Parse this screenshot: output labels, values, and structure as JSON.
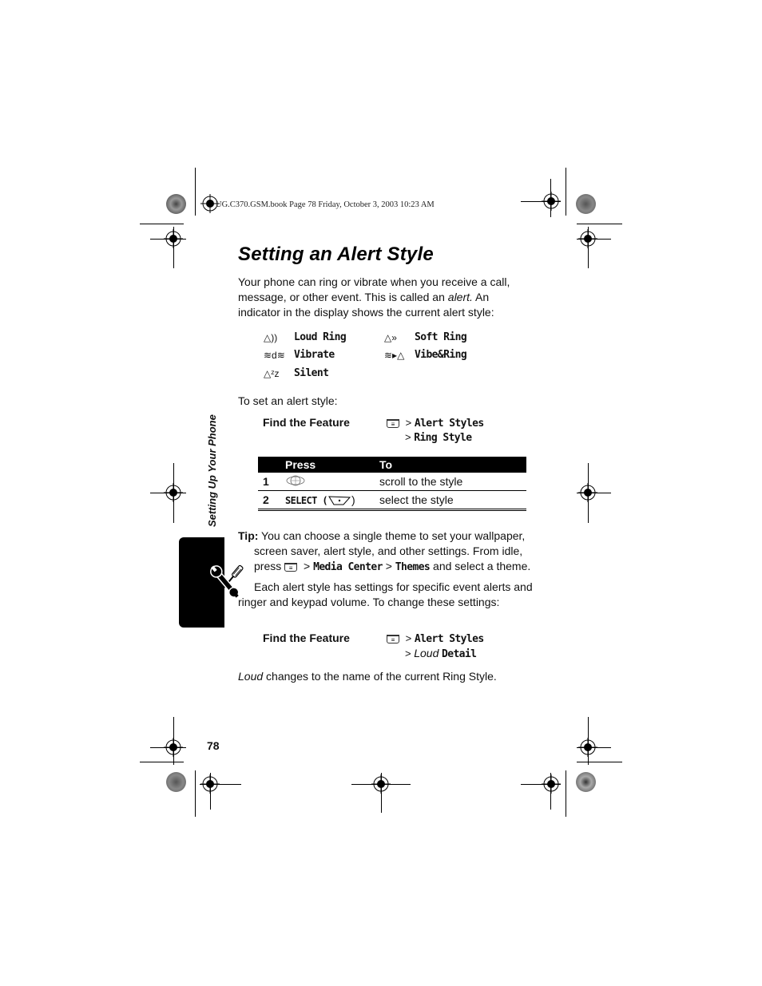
{
  "header": {
    "file_info": "UG.C370.GSM.book  Page 78  Friday, October 3, 2003  10:23 AM"
  },
  "title": "Setting an Alert Style",
  "intro": {
    "part1": "Your phone can ring or vibrate when you receive a call, message, or other event. This is called an ",
    "italic": "alert.",
    "part2": " An indicator in the display shows the current alert style:"
  },
  "alert_styles": [
    {
      "icon": "loud-ring-icon",
      "glyph": "△))",
      "label": "Loud Ring"
    },
    {
      "icon": "soft-ring-icon",
      "glyph": "△»",
      "label": "Soft Ring"
    },
    {
      "icon": "vibrate-icon",
      "glyph": "≋d≋",
      "label": "Vibrate"
    },
    {
      "icon": "vibe-ring-icon",
      "glyph": "≋▸△",
      "label": "Vibe&Ring"
    },
    {
      "icon": "silent-icon",
      "glyph": "△ᶻz",
      "label": "Silent"
    }
  ],
  "to_set": "To set an alert style:",
  "find_feature_1": {
    "label": "Find the Feature",
    "menu_key": "≡",
    "line1_sep": ">",
    "line1": "Alert Styles",
    "line2_sep": ">",
    "line2": "Ring Style"
  },
  "steps_table": {
    "headers": [
      "",
      "Press",
      "To"
    ],
    "rows": [
      {
        "num": "1",
        "press": "",
        "press_icon": "nav-key-icon",
        "to": "scroll to the style"
      },
      {
        "num": "2",
        "press": "SELECT (",
        "press_icon": "left-soft-key-icon",
        "press_end": ")",
        "to": "select the style"
      }
    ]
  },
  "tip": {
    "label": "Tip:",
    "text1": " You can choose a single theme to set your wallpaper, screen saver, alert style, and other settings. From idle, press ",
    "sep1": " > ",
    "item1": "Media Center",
    "sep2": " > ",
    "item2": "Themes",
    "text2": " and select a theme."
  },
  "each_alert": "Each alert style has settings for specific event alerts and ringer and keypad volume. To change these settings:",
  "find_feature_2": {
    "label": "Find the Feature",
    "menu_key": "≡",
    "line1_sep": ">",
    "line1": "Alert Styles",
    "line2_sep": ">",
    "line2_italic": "Loud",
    "line2": "Detail"
  },
  "loud_note": {
    "italic": "Loud",
    "text": " changes to the name of the current Ring Style."
  },
  "side_tab": {
    "title": "Setting Up Your Phone",
    "icon": "tools-icon"
  },
  "page_number": "78"
}
